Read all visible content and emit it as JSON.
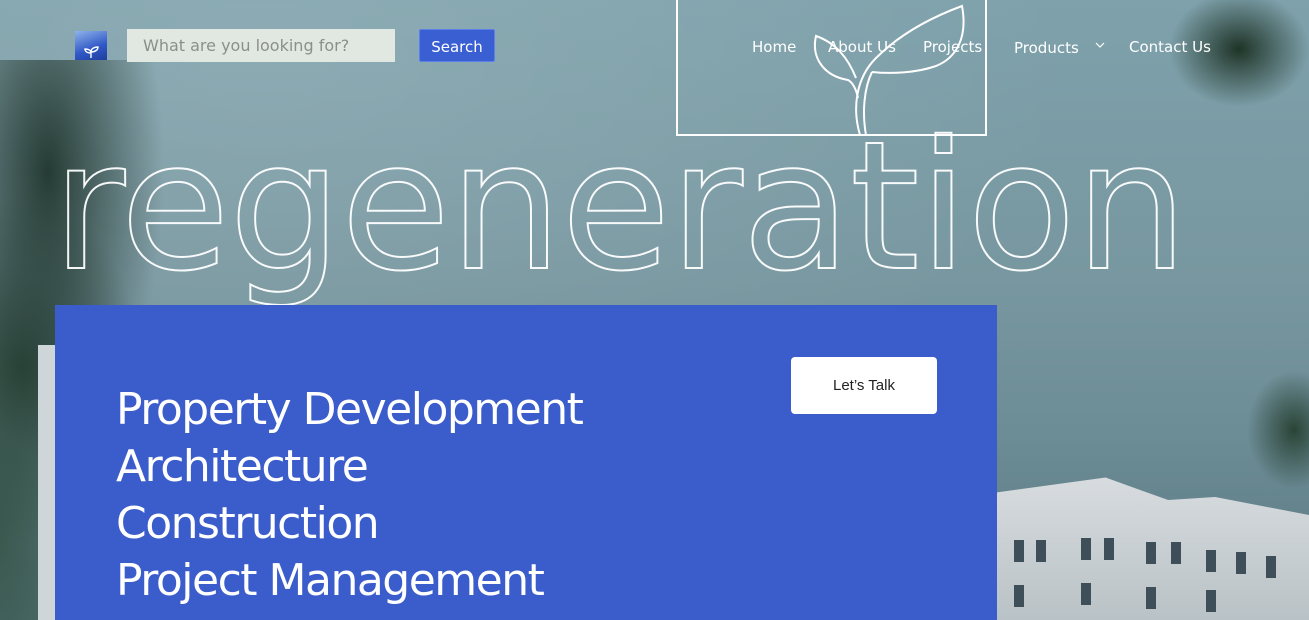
{
  "header": {
    "search": {
      "placeholder": "What are you looking for?",
      "button_label": "Search"
    },
    "nav": [
      {
        "label": "Home"
      },
      {
        "label": "About Us"
      },
      {
        "label": "Projects"
      },
      {
        "label": "Products"
      },
      {
        "label": "Contact Us"
      }
    ]
  },
  "hero": {
    "headline": "regeneration",
    "services": [
      "Property Development",
      "Architecture",
      "Construction",
      "Project Management"
    ],
    "cta_label": "Let’s Talk"
  },
  "colors": {
    "accent": "#3b5dcb",
    "button": "#3a5fd2"
  },
  "icons": [
    "logo-sprout-icon",
    "leaf-outline-icon",
    "chevron-down-icon"
  ]
}
